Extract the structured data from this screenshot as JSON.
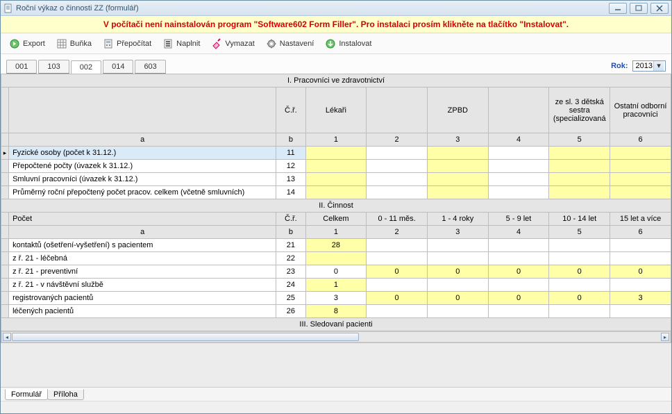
{
  "window_title": "Roční výkaz o činnosti ZZ (formulář)",
  "banner": "V počítači není nainstalován program \"Software602 Form Filler\". Pro instalaci prosím klikněte na tlačítko \"Instalovat\".",
  "toolbar": {
    "export": "Export",
    "bunka": "Buňka",
    "prepocitat": "Přepočítat",
    "naplnit": "Naplnit",
    "vymazat": "Vymazat",
    "nastaveni": "Nastavení",
    "instalovat": "Instalovat"
  },
  "tabs": [
    "001",
    "103",
    "002",
    "014",
    "603"
  ],
  "active_tab": "002",
  "year_label": "Rok:",
  "year_value": "2013",
  "section1": {
    "title": "I. Pracovníci ve zdravotnictví",
    "headers": {
      "cr": "Č.ř.",
      "c1": "Lékaři",
      "c2": "",
      "c3": "ZPBD",
      "c4": "",
      "c5": "ze sl. 3 dětská sestra (specializovaná",
      "c6": "Ostatní odborní pracovníci"
    },
    "subheaders": {
      "a": "a",
      "b": "b",
      "c1": "1",
      "c2": "2",
      "c3": "3",
      "c4": "4",
      "c5": "5",
      "c6": "6"
    },
    "rows": [
      {
        "label": "Fyzické osoby (počet k 31.12.)",
        "cr": "11",
        "c1": "",
        "c2": "",
        "c3": "",
        "c4": "",
        "c5": "",
        "c6": "",
        "y": [
          1,
          3,
          5,
          6
        ]
      },
      {
        "label": "Přepočtené počty (úvazek k 31.12.)",
        "cr": "12",
        "c1": "",
        "c2": "",
        "c3": "",
        "c4": "",
        "c5": "",
        "c6": "",
        "y": [
          1,
          3,
          5,
          6
        ]
      },
      {
        "label": "Smluvní pracovníci (úvazek k 31.12.)",
        "cr": "13",
        "c1": "",
        "c2": "",
        "c3": "",
        "c4": "",
        "c5": "",
        "c6": "",
        "y": [
          1,
          3,
          5,
          6
        ]
      },
      {
        "label": "Průměrný roční přepočtený počet  pracov. celkem (včetně smluvních)",
        "cr": "14",
        "c1": "",
        "c2": "",
        "c3": "",
        "c4": "",
        "c5": "",
        "c6": "",
        "y": [
          1,
          3,
          5,
          6
        ],
        "wrap": true
      }
    ]
  },
  "section2": {
    "title": "II. Činnost",
    "headers": {
      "a": "Počet",
      "cr": "Č.ř.",
      "c1": "Celkem",
      "c2": "0 - 11 měs.",
      "c3": "1 - 4 roky",
      "c4": "5 - 9 let",
      "c5": "10 - 14 let",
      "c6": "15 let a více"
    },
    "subheaders": {
      "a": "a",
      "b": "b",
      "c1": "1",
      "c2": "2",
      "c3": "3",
      "c4": "4",
      "c5": "5",
      "c6": "6"
    },
    "rows": [
      {
        "label": "kontaktů (ošetření-vyšetření) s pacientem",
        "cr": "21",
        "c1": "28",
        "c2": "",
        "c3": "",
        "c4": "",
        "c5": "",
        "c6": "",
        "y": [
          1
        ]
      },
      {
        "label": "z ř. 21 - léčebná",
        "cr": "22",
        "c1": "",
        "c2": "",
        "c3": "",
        "c4": "",
        "c5": "",
        "c6": "",
        "y": [
          1
        ]
      },
      {
        "label": "z ř. 21 - preventivní",
        "cr": "23",
        "c1": "0",
        "c2": "0",
        "c3": "0",
        "c4": "0",
        "c5": "0",
        "c6": "0",
        "y": [
          2,
          3,
          4,
          5,
          6
        ]
      },
      {
        "label": "z ř. 21 - v návštěvní službě",
        "cr": "24",
        "c1": "1",
        "c2": "",
        "c3": "",
        "c4": "",
        "c5": "",
        "c6": "",
        "y": [
          1
        ]
      },
      {
        "label": "registrovaných pacientů",
        "cr": "25",
        "c1": "3",
        "c2": "0",
        "c3": "0",
        "c4": "0",
        "c5": "0",
        "c6": "3",
        "y": [
          2,
          3,
          4,
          5,
          6
        ]
      },
      {
        "label": "léčených pacientů",
        "cr": "26",
        "c1": "8",
        "c2": "",
        "c3": "",
        "c4": "",
        "c5": "",
        "c6": "",
        "y": [
          1
        ]
      }
    ]
  },
  "section3": {
    "title": "III. Sledovaní pacienti"
  },
  "bottom_tabs": {
    "formular": "Formulář",
    "priloha": "Příloha"
  }
}
